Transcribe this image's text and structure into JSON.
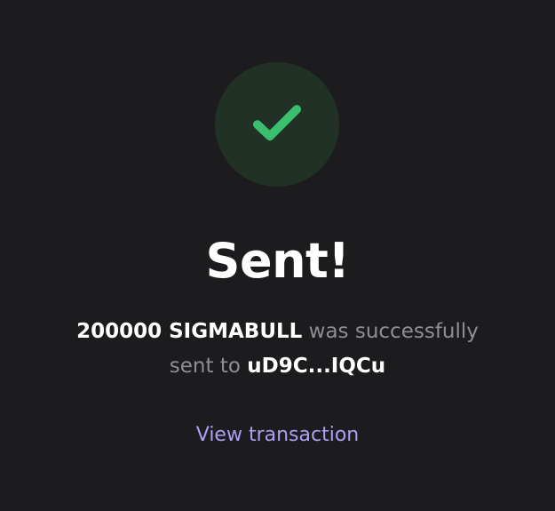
{
  "status": {
    "icon": "check-circle-icon",
    "title": "Sent!"
  },
  "message": {
    "amount_token": "200000 SIGMABULL",
    "text_before_break": " was successfully",
    "text_after_break": "sent to ",
    "recipient": "uD9C...IQCu"
  },
  "actions": {
    "view_transaction": "View transaction"
  },
  "colors": {
    "background": "#1c1c1e",
    "success_badge_bg": "#223125",
    "success_check": "#3bbf6f",
    "muted_text": "#8e8e93",
    "link": "#ab9ff2"
  }
}
